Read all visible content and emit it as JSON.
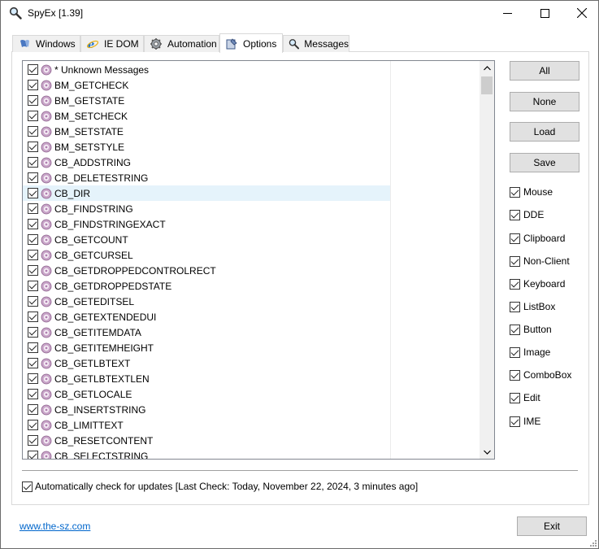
{
  "window": {
    "title": "SpyEx [1.39]"
  },
  "tabs": [
    {
      "label": "Windows",
      "icon": "windows-tab-icon"
    },
    {
      "label": "IE DOM",
      "icon": "ie-icon"
    },
    {
      "label": "Automation",
      "icon": "gear-icon"
    },
    {
      "label": "Options",
      "icon": "options-icon",
      "active": true
    },
    {
      "label": "Messages",
      "icon": "magnifier-icon"
    }
  ],
  "messages": [
    "* Unknown Messages",
    "BM_GETCHECK",
    "BM_GETSTATE",
    "BM_SETCHECK",
    "BM_SETSTATE",
    "BM_SETSTYLE",
    "CB_ADDSTRING",
    "CB_DELETESTRING",
    "CB_DIR",
    "CB_FINDSTRING",
    "CB_FINDSTRINGEXACT",
    "CB_GETCOUNT",
    "CB_GETCURSEL",
    "CB_GETDROPPEDCONTROLRECT",
    "CB_GETDROPPEDSTATE",
    "CB_GETEDITSEL",
    "CB_GETEXTENDEDUI",
    "CB_GETITEMDATA",
    "CB_GETITEMHEIGHT",
    "CB_GETLBTEXT",
    "CB_GETLBTEXTLEN",
    "CB_GETLOCALE",
    "CB_INSERTSTRING",
    "CB_LIMITTEXT",
    "CB_RESETCONTENT",
    "CB_SELECTSTRING"
  ],
  "selected_message": "CB_DIR",
  "buttons": {
    "all": "All",
    "none": "None",
    "load": "Load",
    "save": "Save"
  },
  "filters": [
    "Mouse",
    "DDE",
    "Clipboard",
    "Non-Client",
    "Keyboard",
    "ListBox",
    "Button",
    "Image",
    "ComboBox",
    "Edit",
    "IME"
  ],
  "auto_update_label": "Automatically check for updates [Last Check: Today, November 22, 2024, 3 minutes ago]",
  "footer": {
    "link": "www.the-sz.com",
    "exit": "Exit"
  },
  "colors": {
    "selection": "#e5f3fb",
    "link": "#0066cc",
    "button_face": "#e1e1e1"
  }
}
